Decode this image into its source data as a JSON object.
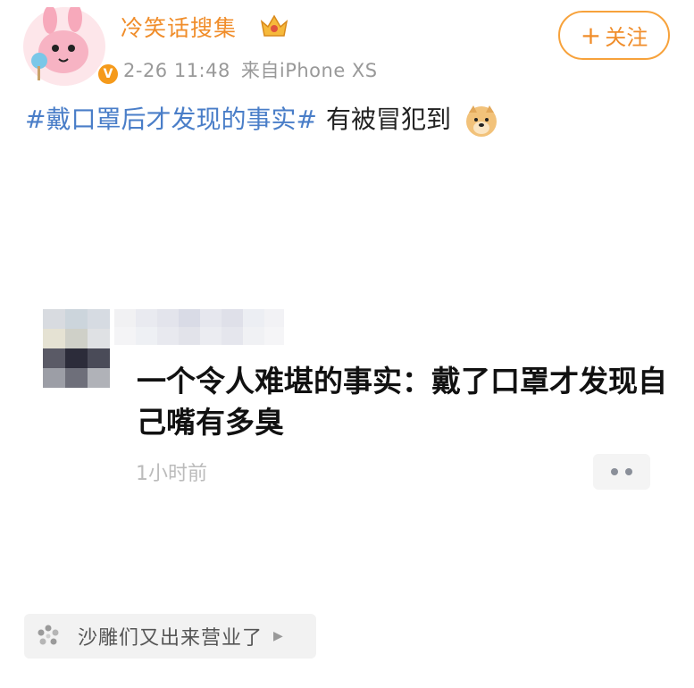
{
  "author": {
    "name": "冷笑话搜集",
    "verified_badge": "V",
    "badge_icon": "crown-icon",
    "timestamp": "2-26 11:48",
    "source": "来自iPhone XS"
  },
  "follow_button": {
    "plus": "+",
    "label": "关注"
  },
  "post": {
    "hashtag": "#戴口罩后才发现的事实#",
    "text": "有被冒犯到",
    "emoji_icon": "doge-icon"
  },
  "quoted_post": {
    "text": "一个令人难堪的事实：戴了口罩才发现自己嘴有多臭",
    "time": "1小时前"
  },
  "chip": {
    "label": "沙雕们又出来营业了",
    "icon": "pinwheel-icon"
  },
  "colors": {
    "username": "#f08d2a",
    "hashtag": "#4a7ec8",
    "follow_border": "#f7a23b",
    "meta": "#999999"
  }
}
